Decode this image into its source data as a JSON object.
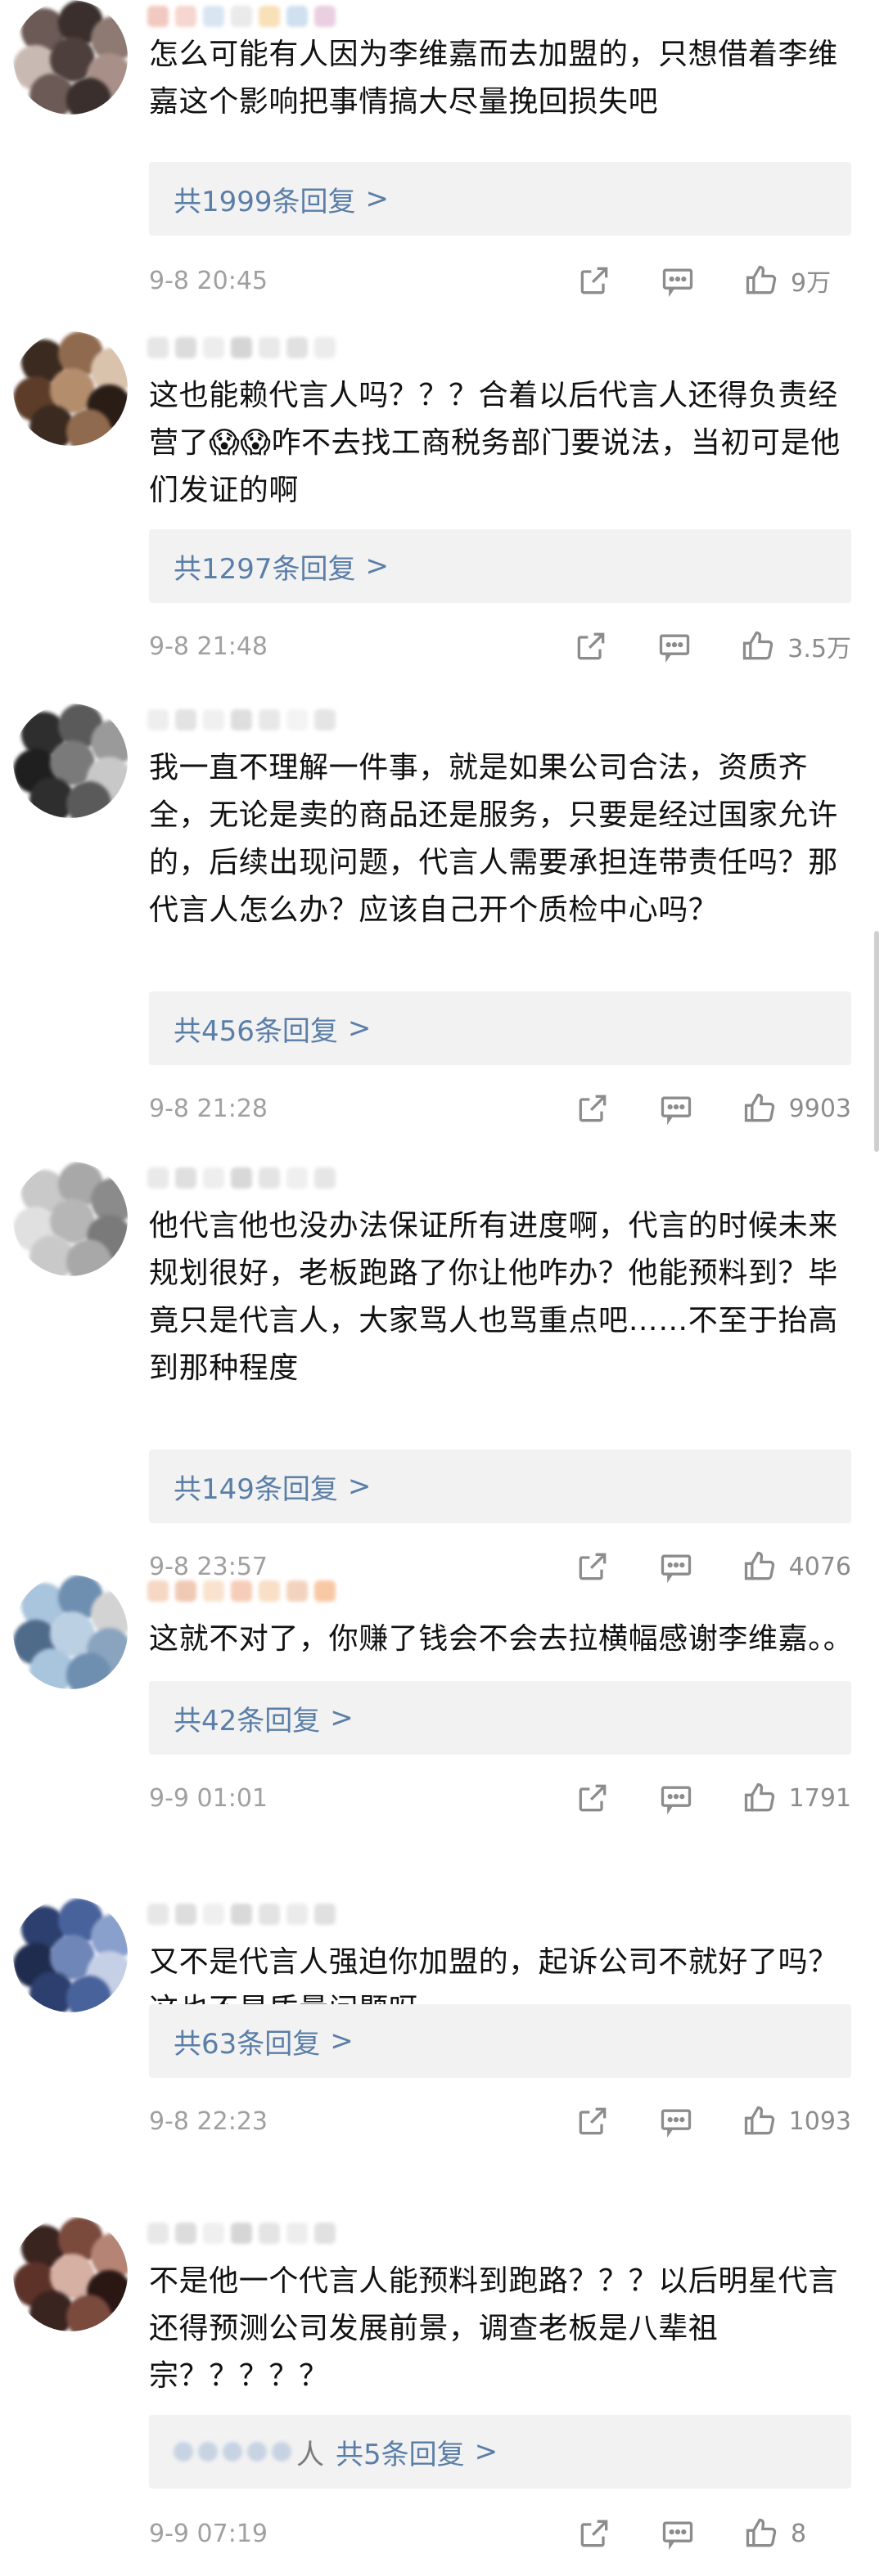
{
  "comments": [
    {
      "text": "怎么可能有人因为李维嘉而去加盟的，只想借着李维嘉这个影响把事情搞大尽量挽回损失吧",
      "replies": "共1999条回复",
      "time": "9-8 20:45",
      "likes": "9万"
    },
    {
      "text": "这也能赖代言人吗？？？合着以后代言人还得负责经营了😱😱咋不去找工商税务部门要说法，当初可是他们发证的啊",
      "replies": "共1297条回复",
      "time": "9-8 21:48",
      "likes": "3.5万"
    },
    {
      "text": "我一直不理解一件事，就是如果公司合法，资质齐全，无论是卖的商品还是服务，只要是经过国家允许的，后续出现问题，代言人需要承担连带责任吗？那代言人怎么办？应该自己开个质检中心吗？",
      "replies": "共456条回复",
      "time": "9-8 21:28",
      "likes": "9903"
    },
    {
      "text": "他代言他也没办法保证所有进度啊，代言的时候未来规划很好，老板跑路了你让他咋办？他能预料到？毕竟只是代言人，大家骂人也骂重点吧……不至于抬高到那种程度",
      "replies": "共149条回复",
      "time": "9-8 23:57",
      "likes": "4076"
    },
    {
      "text": "这就不对了，你赚了钱会不会去拉横幅感谢李维嘉。。",
      "replies": "共42条回复",
      "time": "9-9 01:01",
      "likes": "1791"
    },
    {
      "text": "又不是代言人强迫你加盟的，起诉公司不就好了吗？这也不是质量问题呀",
      "replies": "共63条回复",
      "time": "9-8 22:23",
      "likes": "1093"
    },
    {
      "text": "不是他一个代言人能预料到跑路？？？以后明星代言还得预测公司发展前景，调查老板是八辈祖宗？？？？？",
      "reply_suffix": "人",
      "replies": "共5条回复",
      "time": "9-9 07:19",
      "likes": "8"
    }
  ],
  "reply_chevron": ">",
  "icons": {
    "share": "share-icon",
    "comment": "comment-icon",
    "like": "thumbs-up-icon"
  },
  "colors": {
    "link": "#5a7ea7",
    "reply_bg": "#f2f2f2",
    "meta": "#a0a0a0"
  }
}
